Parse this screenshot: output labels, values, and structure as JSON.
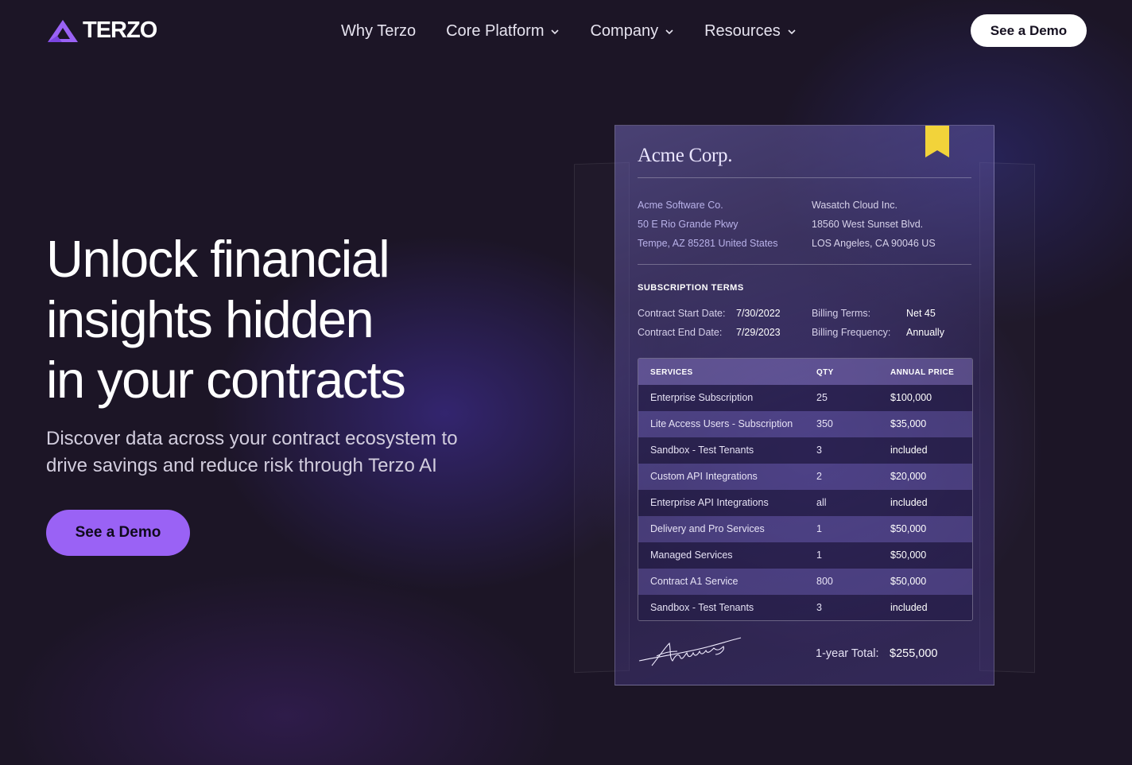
{
  "brand": {
    "name": "TERZO",
    "accent": "#9a62f5"
  },
  "nav": {
    "items": [
      {
        "label": "Why Terzo",
        "dropdown": false
      },
      {
        "label": "Core Platform",
        "dropdown": true
      },
      {
        "label": "Company",
        "dropdown": true
      },
      {
        "label": "Resources",
        "dropdown": true
      }
    ],
    "cta_label": "See a Demo"
  },
  "hero": {
    "title_lines": [
      "Unlock financial",
      "insights hidden",
      "in your contracts"
    ],
    "subtitle": "Discover data across your contract ecosystem to drive savings and reduce risk through Terzo AI",
    "cta_label": "See a Demo"
  },
  "contract": {
    "company": "Acme Corp.",
    "from": [
      "Acme Software Co.",
      "50 E Rio Grande Pkwy",
      "Tempe, AZ 85281 United States"
    ],
    "to": [
      "Wasatch Cloud Inc.",
      "18560 West Sunset Blvd.",
      "LOS Angeles, CA 90046 US"
    ],
    "terms_heading": "SUBSCRIPTION TERMS",
    "terms": {
      "start_label": "Contract Start Date:",
      "start_value": "7/30/2022",
      "end_label": "Contract End Date:",
      "end_value": "7/29/2023",
      "billing_label": "Billing Terms:",
      "billing_value": "Net 45",
      "frequency_label": "Billing Frequency:",
      "frequency_value": "Annually"
    },
    "table": {
      "headers": [
        "SERVICES",
        "QTY",
        "ANNUAL PRICE"
      ],
      "rows": [
        [
          "Enterprise Subscription",
          "25",
          "$100,000"
        ],
        [
          "Lite Access Users - Subscription",
          "350",
          "$35,000"
        ],
        [
          "Sandbox - Test Tenants",
          "3",
          "included"
        ],
        [
          "Custom API Integrations",
          "2",
          "$20,000"
        ],
        [
          "Enterprise API Integrations",
          "all",
          "included"
        ],
        [
          "Delivery and Pro Services",
          "1",
          "$50,000"
        ],
        [
          "Managed Services",
          "1",
          "$50,000"
        ],
        [
          "Contract A1 Service",
          "800",
          "$50,000"
        ],
        [
          "Sandbox - Test Tenants",
          "3",
          "included"
        ]
      ]
    },
    "total_label": "1-year Total:",
    "total_value": "$255,000",
    "bookmark_color": "#f2d33a"
  }
}
